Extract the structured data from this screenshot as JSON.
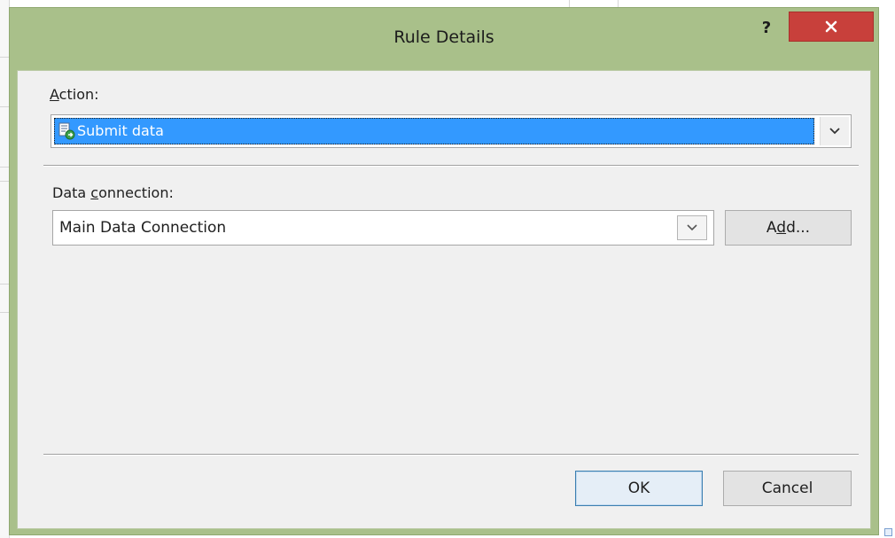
{
  "dialog": {
    "title": "Rule Details",
    "help_label": "?",
    "action_section": {
      "label_underlined": "A",
      "label_rest": "ction:",
      "selected_value": "Submit data",
      "selected_icon": "submit-data-icon"
    },
    "connection_section": {
      "label_before": "Data ",
      "label_underlined": "c",
      "label_after": "onnection:",
      "selected_value": "Main Data Connection",
      "add_button_before": "A",
      "add_button_underlined": "d",
      "add_button_after": "d..."
    },
    "buttons": {
      "ok_label": "OK",
      "cancel_label": "Cancel"
    }
  },
  "colors": {
    "title_bar": "#a9c08a",
    "close_button": "#c8403b",
    "selection_highlight": "#3399ff",
    "client_background": "#f0f0f0",
    "default_button_border": "#3c7fb1"
  }
}
